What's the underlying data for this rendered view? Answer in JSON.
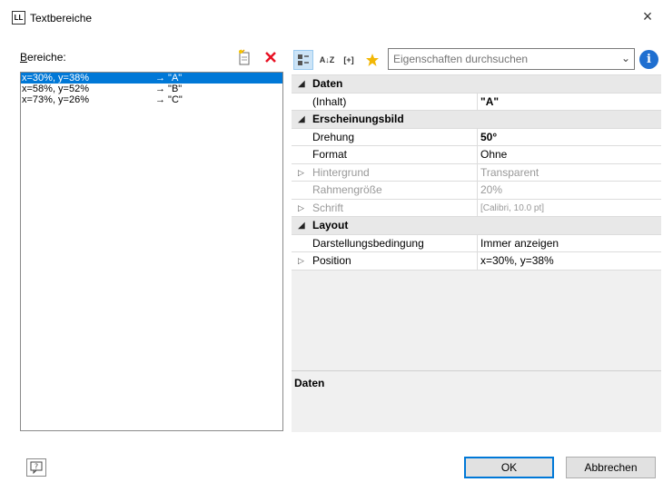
{
  "window": {
    "title": "Textbereiche",
    "app_icon_text": "LL",
    "close_glyph": "×"
  },
  "areas": {
    "label_accel": "B",
    "label_rest": "ereiche:",
    "items": [
      {
        "coord": "x=30%, y=38%",
        "value": "→ \"A\"",
        "selected": true
      },
      {
        "coord": "x=58%, y=52%",
        "value": "→ \"B\"",
        "selected": false
      },
      {
        "coord": "x=73%, y=26%",
        "value": "→ \"C\"",
        "selected": false
      }
    ]
  },
  "toolbar": {
    "categorized_icon": "categorized-view-icon",
    "sort_icon": "sort-az-icon",
    "sort_glyph": "A↓Z",
    "formula_icon": "formula-icon",
    "formula_glyph": "[+]",
    "favorites_icon": "star-icon",
    "search_placeholder": "Eigenschaften durchsuchen",
    "info_glyph": "i"
  },
  "properties": {
    "rows": [
      {
        "type": "cat",
        "key": "Daten",
        "value": ""
      },
      {
        "type": "item",
        "key": "(Inhalt)",
        "value": "\"A\"",
        "bold": true
      },
      {
        "type": "cat",
        "key": "Erscheinungsbild",
        "value": ""
      },
      {
        "type": "item",
        "key": "Drehung",
        "value": "50°",
        "bold": true
      },
      {
        "type": "item",
        "key": "Format",
        "value": "Ohne"
      },
      {
        "type": "item",
        "key": "Hintergrund",
        "value": "Transparent",
        "disabled": true,
        "expandable": true
      },
      {
        "type": "item",
        "key": "Rahmengröße",
        "value": "20%",
        "disabled": true
      },
      {
        "type": "item",
        "key": "Schrift",
        "value": "[Calibri, 10.0 pt]",
        "disabled": true,
        "expandable": true,
        "small": true
      },
      {
        "type": "cat",
        "key": "Layout",
        "value": ""
      },
      {
        "type": "item",
        "key": "Darstellungsbedingung",
        "value": "Immer anzeigen"
      },
      {
        "type": "item",
        "key": "Position",
        "value": "x=30%, y=38%",
        "expandable": true
      }
    ]
  },
  "description": {
    "title": "Daten"
  },
  "buttons": {
    "ok": "OK",
    "cancel": "Abbrechen",
    "help_glyph": "?"
  },
  "colors": {
    "selection": "#0078d7",
    "delete_red": "#e81123",
    "star": "#f2b705",
    "info_blue": "#1f6fd0"
  }
}
